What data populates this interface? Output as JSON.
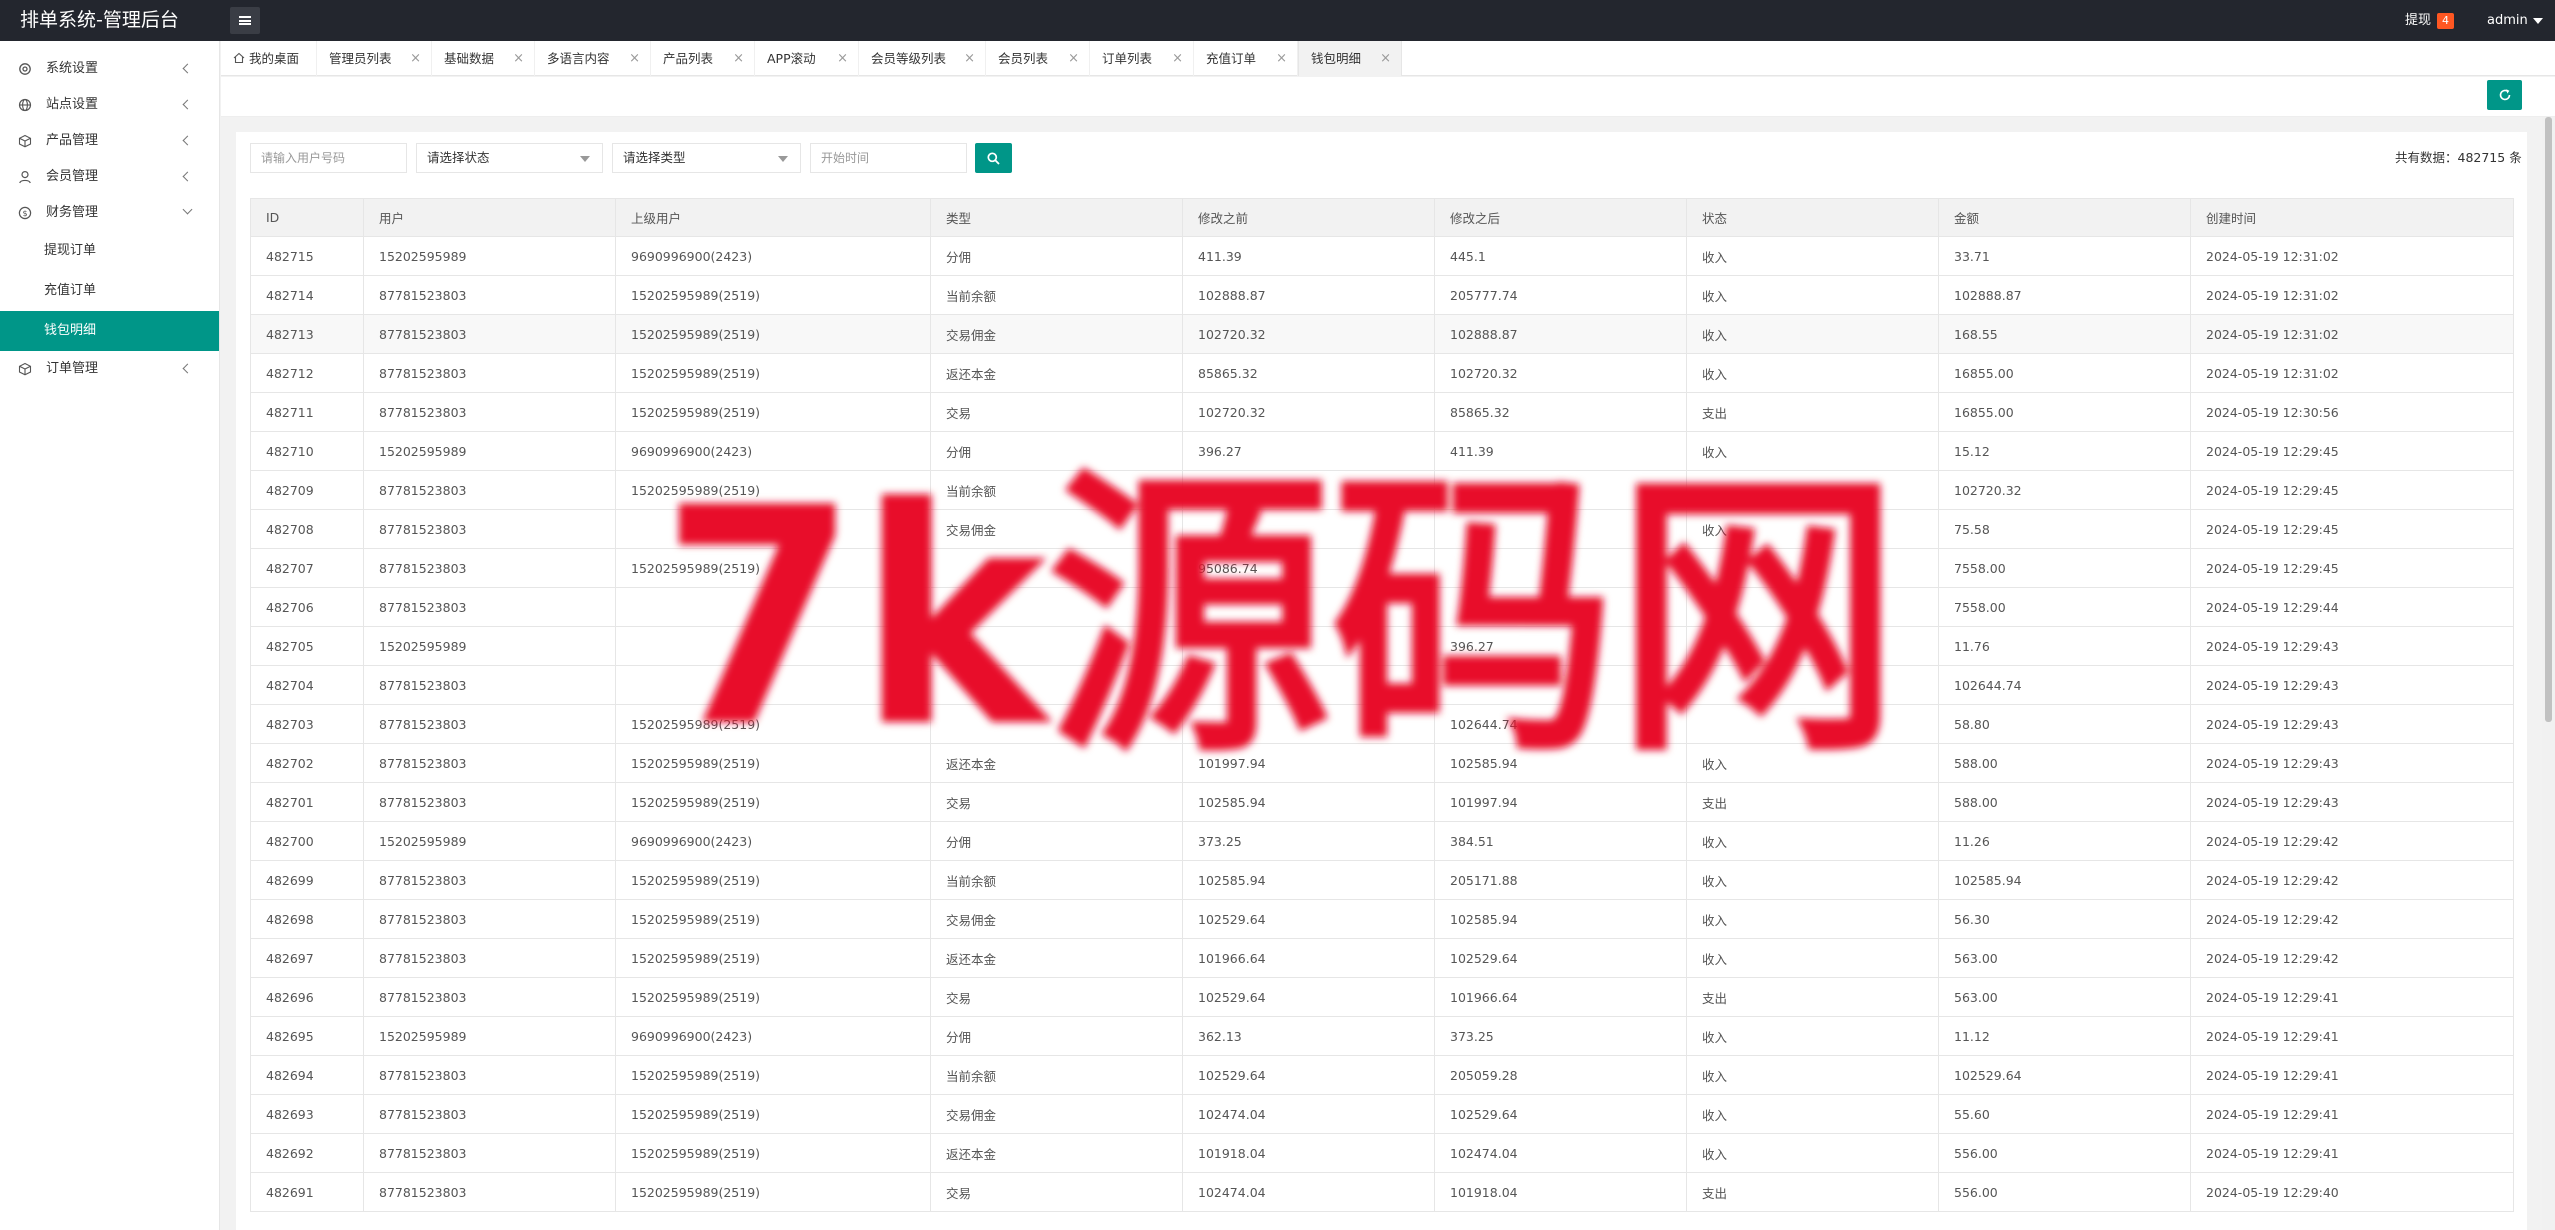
{
  "header": {
    "brand": "排单系统-管理后台",
    "withdraw_label": "提现",
    "withdraw_badge": "4",
    "user_name": "admin"
  },
  "sidebar": {
    "items": [
      {
        "label": "系统设置",
        "icon": "gear-icon",
        "expanded": false
      },
      {
        "label": "站点设置",
        "icon": "globe-icon",
        "expanded": false
      },
      {
        "label": "产品管理",
        "icon": "cube-icon",
        "expanded": false
      },
      {
        "label": "会员管理",
        "icon": "user-icon",
        "expanded": false
      },
      {
        "label": "财务管理",
        "icon": "dollar-icon",
        "expanded": true,
        "children": [
          "提现订单",
          "充值订单",
          "钱包明细"
        ],
        "active_child": "钱包明细"
      },
      {
        "label": "订单管理",
        "icon": "cube-icon",
        "expanded": false
      }
    ]
  },
  "tabs": [
    {
      "label": "我的桌面",
      "icon": "home-icon",
      "closable": false
    },
    {
      "label": "管理员列表"
    },
    {
      "label": "基础数据"
    },
    {
      "label": "多语言内容"
    },
    {
      "label": "产品列表"
    },
    {
      "label": "APP滚动"
    },
    {
      "label": "会员等级列表"
    },
    {
      "label": "会员列表"
    },
    {
      "label": "订单列表"
    },
    {
      "label": "充值订单"
    },
    {
      "label": "钱包明细",
      "active": true
    }
  ],
  "filters": {
    "user_placeholder": "请输入用户号码",
    "status_select": "请选择状态",
    "type_select": "请选择类型",
    "time_placeholder": "开始时间"
  },
  "total_label": "共有数据：482715 条",
  "table": {
    "columns": [
      "ID",
      "用户",
      "上级用户",
      "类型",
      "修改之前",
      "修改之后",
      "状态",
      "金额",
      "创建时间"
    ],
    "rows": [
      [
        "482715",
        "15202595989",
        "9690996900(2423)",
        "分佣",
        "411.39",
        "445.1",
        "收入",
        "33.71",
        "2024-05-19 12:31:02"
      ],
      [
        "482714",
        "87781523803",
        "15202595989(2519)",
        "当前余额",
        "102888.87",
        "205777.74",
        "收入",
        "102888.87",
        "2024-05-19 12:31:02"
      ],
      [
        "482713",
        "87781523803",
        "15202595989(2519)",
        "交易佣金",
        "102720.32",
        "102888.87",
        "收入",
        "168.55",
        "2024-05-19 12:31:02"
      ],
      [
        "482712",
        "87781523803",
        "15202595989(2519)",
        "返还本金",
        "85865.32",
        "102720.32",
        "收入",
        "16855.00",
        "2024-05-19 12:31:02"
      ],
      [
        "482711",
        "87781523803",
        "15202595989(2519)",
        "交易",
        "102720.32",
        "85865.32",
        "支出",
        "16855.00",
        "2024-05-19 12:30:56"
      ],
      [
        "482710",
        "15202595989",
        "9690996900(2423)",
        "分佣",
        "396.27",
        "411.39",
        "收入",
        "15.12",
        "2024-05-19 12:29:45"
      ],
      [
        "482709",
        "87781523803",
        "15202595989(2519)",
        "当前余额",
        "",
        "",
        "",
        "102720.32",
        "2024-05-19 12:29:45"
      ],
      [
        "482708",
        "87781523803",
        "",
        "交易佣金",
        "",
        "",
        "收入",
        "75.58",
        "2024-05-19 12:29:45"
      ],
      [
        "482707",
        "87781523803",
        "15202595989(2519)",
        "",
        "95086.74",
        "",
        "",
        "7558.00",
        "2024-05-19 12:29:45"
      ],
      [
        "482706",
        "87781523803",
        "",
        "",
        "",
        "",
        "",
        "7558.00",
        "2024-05-19 12:29:44"
      ],
      [
        "482705",
        "15202595989",
        "",
        "分佣",
        "",
        "396.27",
        "",
        "11.76",
        "2024-05-19 12:29:43"
      ],
      [
        "482704",
        "87781523803",
        "",
        "",
        "",
        "",
        "",
        "102644.74",
        "2024-05-19 12:29:43"
      ],
      [
        "482703",
        "87781523803",
        "15202595989(2519)",
        "",
        "",
        "102644.74",
        "",
        "58.80",
        "2024-05-19 12:29:43"
      ],
      [
        "482702",
        "87781523803",
        "15202595989(2519)",
        "返还本金",
        "101997.94",
        "102585.94",
        "收入",
        "588.00",
        "2024-05-19 12:29:43"
      ],
      [
        "482701",
        "87781523803",
        "15202595989(2519)",
        "交易",
        "102585.94",
        "101997.94",
        "支出",
        "588.00",
        "2024-05-19 12:29:43"
      ],
      [
        "482700",
        "15202595989",
        "9690996900(2423)",
        "分佣",
        "373.25",
        "384.51",
        "收入",
        "11.26",
        "2024-05-19 12:29:42"
      ],
      [
        "482699",
        "87781523803",
        "15202595989(2519)",
        "当前余额",
        "102585.94",
        "205171.88",
        "收入",
        "102585.94",
        "2024-05-19 12:29:42"
      ],
      [
        "482698",
        "87781523803",
        "15202595989(2519)",
        "交易佣金",
        "102529.64",
        "102585.94",
        "收入",
        "56.30",
        "2024-05-19 12:29:42"
      ],
      [
        "482697",
        "87781523803",
        "15202595989(2519)",
        "返还本金",
        "101966.64",
        "102529.64",
        "收入",
        "563.00",
        "2024-05-19 12:29:42"
      ],
      [
        "482696",
        "87781523803",
        "15202595989(2519)",
        "交易",
        "102529.64",
        "101966.64",
        "支出",
        "563.00",
        "2024-05-19 12:29:41"
      ],
      [
        "482695",
        "15202595989",
        "9690996900(2423)",
        "分佣",
        "362.13",
        "373.25",
        "收入",
        "11.12",
        "2024-05-19 12:29:41"
      ],
      [
        "482694",
        "87781523803",
        "15202595989(2519)",
        "当前余额",
        "102529.64",
        "205059.28",
        "收入",
        "102529.64",
        "2024-05-19 12:29:41"
      ],
      [
        "482693",
        "87781523803",
        "15202595989(2519)",
        "交易佣金",
        "102474.04",
        "102529.64",
        "收入",
        "55.60",
        "2024-05-19 12:29:41"
      ],
      [
        "482692",
        "87781523803",
        "15202595989(2519)",
        "返还本金",
        "101918.04",
        "102474.04",
        "收入",
        "556.00",
        "2024-05-19 12:29:41"
      ],
      [
        "482691",
        "87781523803",
        "15202595989(2519)",
        "交易",
        "102474.04",
        "101918.04",
        "支出",
        "556.00",
        "2024-05-19 12:29:40"
      ]
    ]
  },
  "watermark": {
    "text": "7k源码网",
    "color": "#e8102a"
  },
  "colors": {
    "accent": "#009688",
    "header_bg": "#23262e",
    "badge": "#ff5722"
  }
}
